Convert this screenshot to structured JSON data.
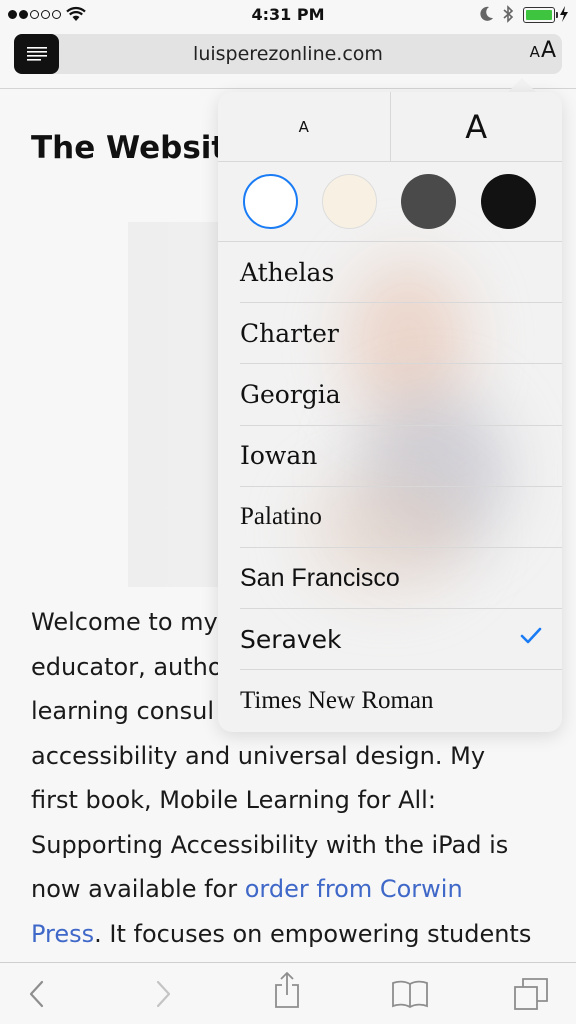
{
  "status_bar": {
    "time": "4:31 PM",
    "signal_dots_filled": 2,
    "signal_dots_total": 5,
    "battery_level": 1.0,
    "battery_color": "#3ec43e"
  },
  "url_bar": {
    "url": "luisperezonline.com",
    "aa_small": "A",
    "aa_large": "A"
  },
  "article": {
    "title": "The Website",
    "body_lines": [
      "Welcome to my",
      "educator, autho",
      "learning consul",
      "accessibility and universal design. My",
      "first book, Mobile Learning for All:",
      "Supporting Accessibility with the iPad is"
    ],
    "line7_prefix": "now available for ",
    "link_part1": "order from Corwin",
    "link_part2": "Press",
    "line8_suffix": ". It focuses on empowering students",
    "link_color": "#3f68c8"
  },
  "popover": {
    "size_small_label": "A",
    "size_large_label": "A",
    "themes": [
      {
        "name": "white",
        "color": "#ffffff",
        "selected": true
      },
      {
        "name": "sepia",
        "color": "#f8f1e3",
        "selected": false
      },
      {
        "name": "gray",
        "color": "#4a4a4a",
        "selected": false
      },
      {
        "name": "night",
        "color": "#121212",
        "selected": false
      }
    ],
    "selection_color": "#1a7cf5",
    "fonts": [
      {
        "label": "Athelas",
        "selected": false
      },
      {
        "label": "Charter",
        "selected": false
      },
      {
        "label": "Georgia",
        "selected": false
      },
      {
        "label": "Iowan",
        "selected": false
      },
      {
        "label": "Palatino",
        "selected": false
      },
      {
        "label": "San Francisco",
        "selected": false
      },
      {
        "label": "Seravek",
        "selected": true
      },
      {
        "label": "Times New Roman",
        "selected": false
      }
    ]
  },
  "toolbar": {
    "icons": [
      "back-icon",
      "forward-icon",
      "share-icon",
      "bookmarks-icon",
      "tabs-icon"
    ]
  }
}
